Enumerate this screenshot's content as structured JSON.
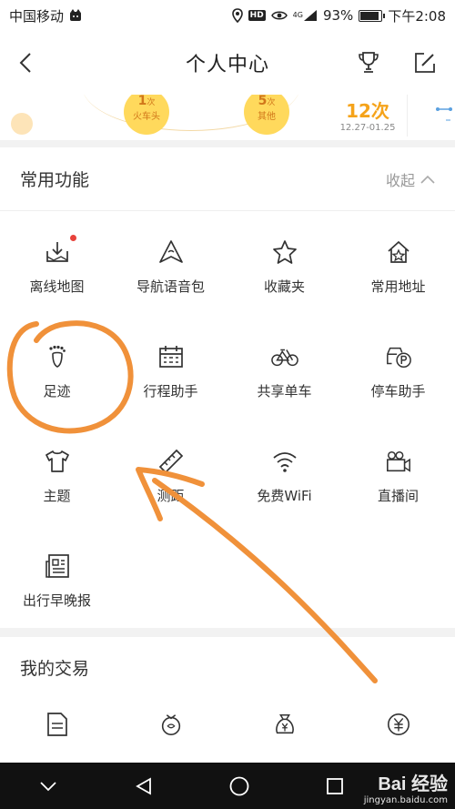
{
  "status_bar": {
    "carrier": "中国移动",
    "hd": "HD",
    "network": "4G",
    "battery_text": "93%",
    "battery_level": 0.93,
    "time": "下午2:08"
  },
  "header": {
    "title": "个人中心",
    "icons": [
      "back-icon",
      "trophy-icon",
      "edit-icon"
    ]
  },
  "stats": {
    "bubbles": [
      {
        "count": "1",
        "unit": "次",
        "label": "火车头"
      },
      {
        "count": "5",
        "unit": "次",
        "label": "其他"
      }
    ],
    "total": "12次",
    "date_range": "12.27-01.25"
  },
  "common": {
    "title": "常用功能",
    "collapse_label": "收起",
    "items": [
      {
        "label": "离线地图",
        "icon": "offline-map-icon",
        "badge": true
      },
      {
        "label": "导航语音包",
        "icon": "voice-pack-icon"
      },
      {
        "label": "收藏夹",
        "icon": "star-icon"
      },
      {
        "label": "常用地址",
        "icon": "home-star-icon"
      },
      {
        "label": "足迹",
        "icon": "footprint-icon"
      },
      {
        "label": "行程助手",
        "icon": "calendar-icon"
      },
      {
        "label": "共享单车",
        "icon": "bicycle-icon"
      },
      {
        "label": "停车助手",
        "icon": "parking-car-icon"
      },
      {
        "label": "主题",
        "icon": "tshirt-icon"
      },
      {
        "label": "测距",
        "icon": "ruler-icon"
      },
      {
        "label": "免费WiFi",
        "icon": "wifi-icon"
      },
      {
        "label": "直播间",
        "icon": "video-camera-icon"
      },
      {
        "label": "出行早晚报",
        "icon": "newspaper-icon"
      }
    ]
  },
  "trade": {
    "title": "我的交易",
    "icons": [
      "document-icon",
      "coupon-icon",
      "money-bag-icon",
      "yuan-coin-icon"
    ]
  },
  "watermark": {
    "main": "Bai 经验",
    "sub": "jingyan.baidu.com"
  },
  "colors": {
    "accent_orange": "#f0913a",
    "bubble_yellow": "#ffd95c",
    "badge_red": "#e8423b"
  }
}
